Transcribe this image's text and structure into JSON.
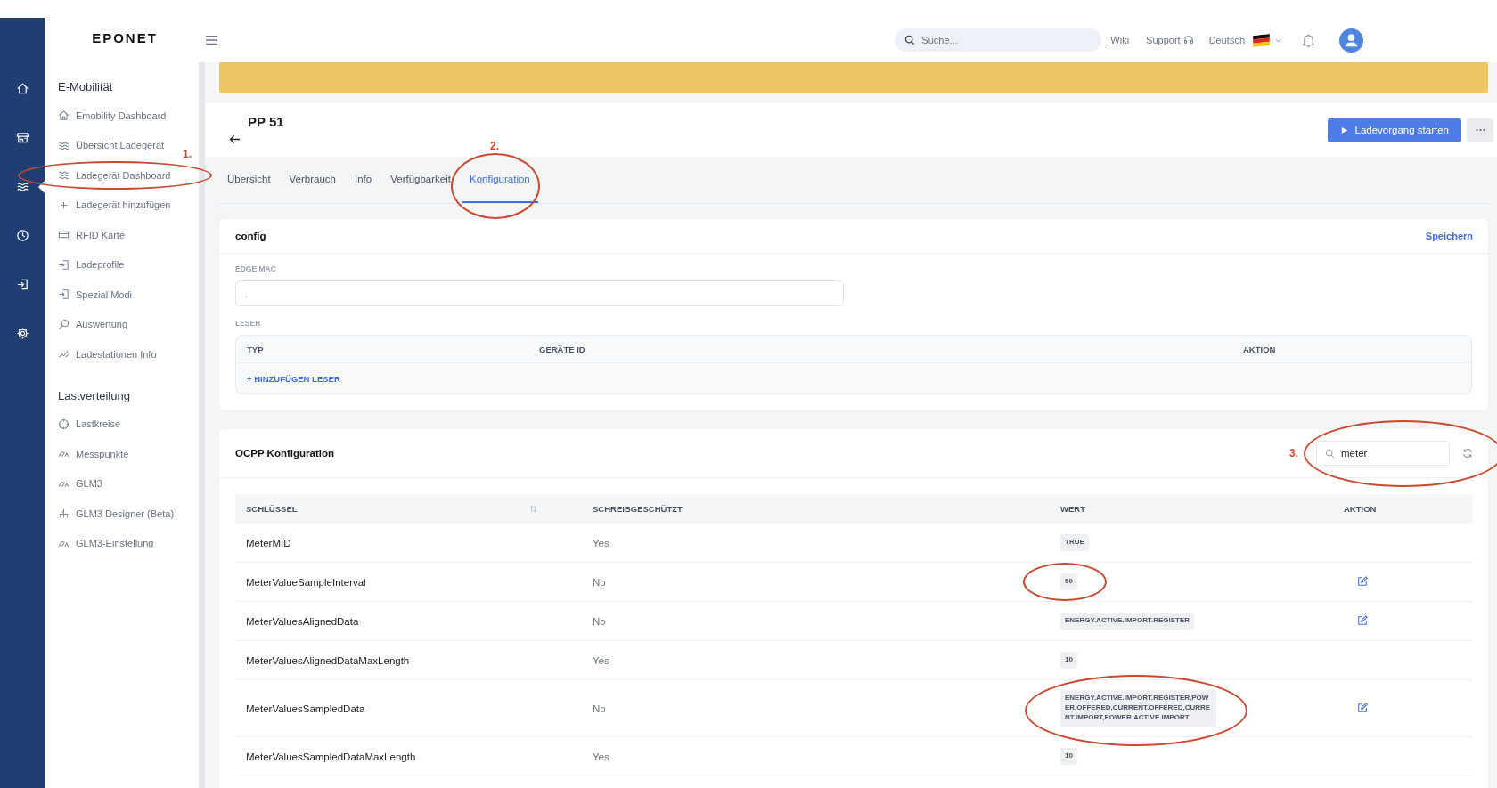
{
  "rail": [
    {
      "kind": "home",
      "selected": false
    },
    {
      "kind": "store",
      "selected": false
    },
    {
      "kind": "waves",
      "selected": true
    },
    {
      "kind": "clock",
      "selected": false
    },
    {
      "kind": "login",
      "selected": false
    },
    {
      "kind": "gear",
      "selected": false
    }
  ],
  "logo": "EPONET",
  "sidebar": {
    "sections": [
      {
        "title": "E-Mobilität",
        "items": [
          {
            "label": "Emobility Dashboard",
            "kind": "home"
          },
          {
            "label": "Übersicht Ladegerät",
            "kind": "waves"
          },
          {
            "label": "Ladegerät Dashboard",
            "kind": "waves",
            "annotation": "1."
          },
          {
            "label": "Ladegerät hinzufügen",
            "kind": "plus"
          },
          {
            "label": "RFID Karte",
            "kind": "card"
          },
          {
            "label": "Ladeprofile",
            "kind": "login"
          },
          {
            "label": "Spezial Modi",
            "kind": "login"
          },
          {
            "label": "Auswertung",
            "kind": "search"
          },
          {
            "label": "Ladestationen Info",
            "kind": "chart"
          }
        ]
      },
      {
        "title": "Lastverteilung",
        "items": [
          {
            "label": "Lastkreise",
            "kind": "circle"
          },
          {
            "label": "Messpunkte",
            "kind": "gauge"
          },
          {
            "label": "GLM3",
            "kind": "gauge"
          },
          {
            "label": "GLM3 Designer (Beta)",
            "kind": "tree"
          },
          {
            "label": "GLM3-Einstellung",
            "kind": "gauge"
          }
        ]
      }
    ]
  },
  "topbar": {
    "search": {
      "placeholder": "Suche..."
    },
    "wiki": "Wiki",
    "support": "Support",
    "language": "Deutsch"
  },
  "header": {
    "title": "PP 51",
    "primary_button": "Ladevorgang starten"
  },
  "tabs": [
    {
      "label": "Übersicht",
      "selected": false
    },
    {
      "label": "Verbrauch",
      "selected": false
    },
    {
      "label": "Info",
      "selected": false
    },
    {
      "label": "Verfügbarkeit",
      "selected": false
    },
    {
      "label": "Konfiguration",
      "selected": true,
      "annotation": "2."
    }
  ],
  "config_card": {
    "title": "config",
    "save": "Speichern",
    "edge_mac": {
      "label": "EDGE MAC",
      "placeholder": "."
    },
    "leser": {
      "label": "LESER",
      "columns": [
        "TYP",
        "GERÄTE ID",
        "AKTION"
      ],
      "add": "+ HINZUFÜGEN LESER"
    }
  },
  "ocpp": {
    "title": "OCPP Konfiguration",
    "annotation": "3.",
    "search": {
      "value": "meter"
    },
    "columns": [
      "SCHLÜSSEL",
      "SCHREIBGESCHÜTZT",
      "WERT",
      "AKTION"
    ],
    "rows": [
      {
        "key": "MeterMID",
        "readonly": "Yes",
        "value": "TRUE",
        "editable": false,
        "circled": false
      },
      {
        "key": "MeterValueSampleInterval",
        "readonly": "No",
        "value": "50",
        "editable": true,
        "circled": true
      },
      {
        "key": "MeterValuesAlignedData",
        "readonly": "No",
        "value": "ENERGY.ACTIVE.IMPORT.REGISTER",
        "editable": true,
        "circled": false
      },
      {
        "key": "MeterValuesAlignedDataMaxLength",
        "readonly": "Yes",
        "value": "10",
        "editable": false,
        "circled": false
      },
      {
        "key": "MeterValuesSampledData",
        "readonly": "No",
        "value": "ENERGY.ACTIVE.IMPORT.REGISTER,POWER.OFFERED,CURRENT.OFFERED,CURRENT.IMPORT,POWER.ACTIVE.IMPORT",
        "editable": true,
        "circled": true
      },
      {
        "key": "MeterValuesSampledDataMaxLength",
        "readonly": "Yes",
        "value": "10",
        "editable": false,
        "circled": false
      }
    ]
  }
}
